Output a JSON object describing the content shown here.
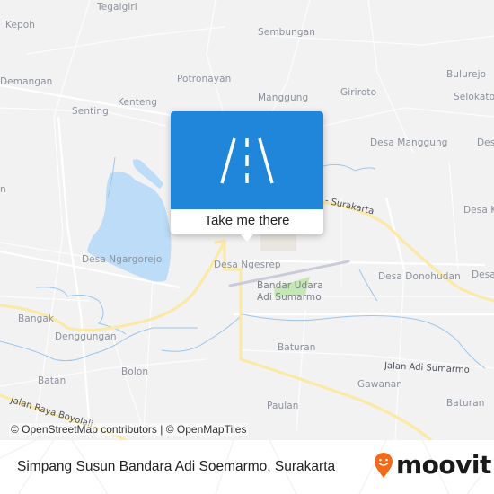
{
  "map": {
    "places": [
      {
        "id": "tegalgiri",
        "label": "Tegalgiri"
      },
      {
        "id": "kepoh",
        "label": "Kepoh"
      },
      {
        "id": "sembungan",
        "label": "Sembungan"
      },
      {
        "id": "demangan",
        "label": "Demangan"
      },
      {
        "id": "potronayan",
        "label": "Potronayan"
      },
      {
        "id": "bulurejo",
        "label": "Bulurejo"
      },
      {
        "id": "selokato",
        "label": "Selokato"
      },
      {
        "id": "senting",
        "label": "Senting"
      },
      {
        "id": "kenteng",
        "label": "Kenteng"
      },
      {
        "id": "manggung",
        "label": "Manggung"
      },
      {
        "id": "giriroto",
        "label": "Giriroto"
      },
      {
        "id": "desa-manggung",
        "label": "Desa Manggung"
      },
      {
        "id": "desa-right-1",
        "label": "Desa"
      },
      {
        "id": "desa-k",
        "label": "Desa K"
      },
      {
        "id": "desa-ngargorejo",
        "label": "Desa Ngargorejo"
      },
      {
        "id": "desa-ngesrep",
        "label": "Desa Ngesrep"
      },
      {
        "id": "bandar-udara-1",
        "label": "Bandar Udara"
      },
      {
        "id": "bandar-udara-2",
        "label": "Adi Sumarmo"
      },
      {
        "id": "desa-donohudan",
        "label": "Desa Donohudan"
      },
      {
        "id": "desa-right-2",
        "label": "Desa"
      },
      {
        "id": "bangak",
        "label": "Bangak"
      },
      {
        "id": "denggungan",
        "label": "Denggungan"
      },
      {
        "id": "baturan-1",
        "label": "Baturan"
      },
      {
        "id": "batan",
        "label": "Batan"
      },
      {
        "id": "bolon",
        "label": "Bolon"
      },
      {
        "id": "gawanan",
        "label": "Gawanan"
      },
      {
        "id": "baturan-2",
        "label": "Baturan"
      },
      {
        "id": "paulan",
        "label": "Paulan"
      },
      {
        "id": "left-edge-n",
        "label": "n"
      }
    ],
    "roads": {
      "surakarta": "- Surakarta",
      "jalan_adi_sumarmo": "Jalan Adi Sumarmo",
      "jalan_raya_boyolali": "Jalan Raya Boyolali"
    },
    "attribution": "© OpenStreetMap contributors | © OpenMapTiles",
    "colors": {
      "land": "#f2f2f3",
      "water": "#bcdcf7",
      "major_road": "#fbe9a6",
      "airport_green": "#b9e3a3",
      "runway": "#c9ccd8"
    }
  },
  "popup": {
    "icon": "road-icon",
    "action_label": "Take me there",
    "header_color": "#1f86da"
  },
  "footer": {
    "title": "Simpang Susun Bandara Adi Soemarmo, Surakarta",
    "logo_text": "moovit",
    "logo_icon": "moovit-pin-icon",
    "brand_color": "#f46a18"
  }
}
